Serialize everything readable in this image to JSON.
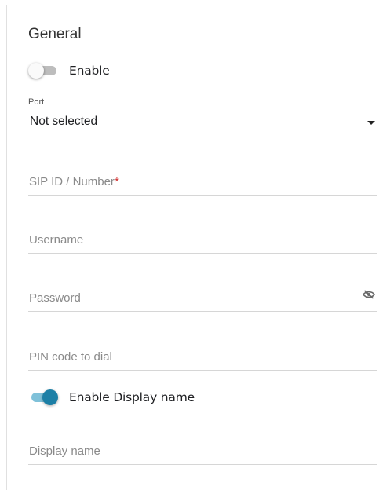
{
  "section": {
    "title": "General"
  },
  "enable": {
    "label": "Enable",
    "checked": false
  },
  "port": {
    "label": "Port",
    "value": "Not selected"
  },
  "sip": {
    "placeholder": "SIP ID / Number",
    "required_mark": "*"
  },
  "username": {
    "placeholder": "Username"
  },
  "password": {
    "placeholder": "Password",
    "icon": "eye-off-icon"
  },
  "pin": {
    "placeholder": "PIN code to dial"
  },
  "display_toggle": {
    "label": "Enable Display name",
    "checked": true
  },
  "display_name": {
    "placeholder": "Display name"
  },
  "colors": {
    "accent": "#1c7fa6",
    "accent_track": "#7fc1d9",
    "required": "#d32f2f"
  }
}
